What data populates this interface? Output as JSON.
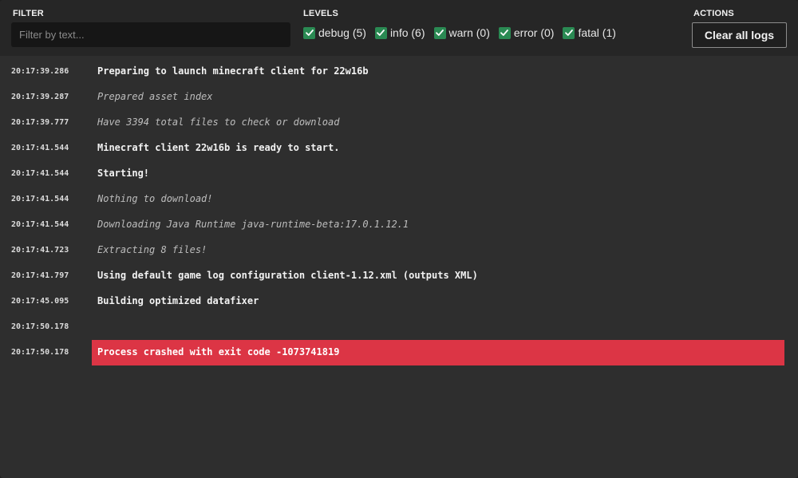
{
  "toolbar": {
    "filter_title": "FILTER",
    "filter_placeholder": "Filter by text...",
    "filter_value": "",
    "levels_title": "LEVELS",
    "levels": [
      {
        "label": "debug (5)",
        "checked": true
      },
      {
        "label": "info (6)",
        "checked": true
      },
      {
        "label": "warn (0)",
        "checked": true
      },
      {
        "label": "error (0)",
        "checked": true
      },
      {
        "label": "fatal (1)",
        "checked": true
      }
    ],
    "actions_title": "ACTIONS",
    "clear_label": "Clear all logs"
  },
  "logs": [
    {
      "time": "20:17:39.286",
      "level": "info",
      "message": "Preparing to launch minecraft client for 22w16b"
    },
    {
      "time": "20:17:39.287",
      "level": "debug",
      "message": "Prepared asset index"
    },
    {
      "time": "20:17:39.777",
      "level": "debug",
      "message": "Have 3394 total files to check or download"
    },
    {
      "time": "20:17:41.544",
      "level": "info",
      "message": "Minecraft client 22w16b is ready to start."
    },
    {
      "time": "20:17:41.544",
      "level": "info",
      "message": "Starting!"
    },
    {
      "time": "20:17:41.544",
      "level": "debug",
      "message": "Nothing to download!"
    },
    {
      "time": "20:17:41.544",
      "level": "debug",
      "message": "Downloading Java Runtime java-runtime-beta:17.0.1.12.1"
    },
    {
      "time": "20:17:41.723",
      "level": "debug",
      "message": "Extracting 8 files!"
    },
    {
      "time": "20:17:41.797",
      "level": "info",
      "message": "Using default game log configuration client-1.12.xml (outputs XML)"
    },
    {
      "time": "20:17:45.095",
      "level": "info",
      "message": "Building optimized datafixer"
    },
    {
      "time": "20:17:50.178",
      "level": "info",
      "message": ""
    },
    {
      "time": "20:17:50.178",
      "level": "fatal",
      "message": "Process crashed with exit code -1073741819"
    }
  ],
  "colors": {
    "checkbox": "#2a8a53",
    "fatal_bg": "#dc3545",
    "panel_bg": "#2e2e2e",
    "toolbar_bg": "#262626"
  },
  "icons": {
    "checkbox": "check-icon"
  }
}
